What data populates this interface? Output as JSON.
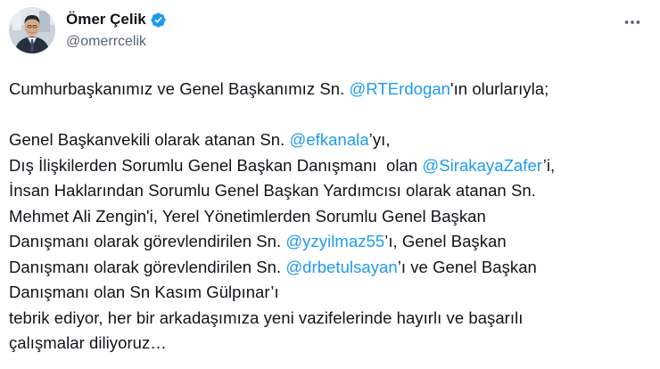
{
  "author": {
    "display_name": "Ömer Çelik",
    "handle": "@omerrcelik",
    "verified": true,
    "brand_color": "#1d9bf0"
  },
  "icons": {
    "more": "more-horizontal-icon",
    "verified": "verified-badge-icon"
  },
  "tweet": {
    "line1": {
      "a": "Cumhurbaşkanımız ve Genel Başkanımız Sn. ",
      "m1": "@RTErdogan",
      "b": "'ın olurlarıyla;"
    },
    "line2": {
      "a": "Genel Başkanvekili olarak atanan Sn. ",
      "m1": "@efkanala",
      "b": "’yı,"
    },
    "line3": {
      "a": "Dış İlişkilerden Sorumlu Genel Başkan Danışmanı  olan ",
      "m1": "@SirakayaZafer",
      "b": "’i,"
    },
    "line4": {
      "a": "İnsan Haklarından Sorumlu Genel Başkan Yardımcısı olarak atanan Sn."
    },
    "line5": {
      "a": "Mehmet Ali Zengin'i, Yerel Yönetimlerden Sorumlu Genel Başkan"
    },
    "line6": {
      "a": "Danışmanı olarak görevlendirilen Sn. ",
      "m1": "@yzyilmaz55",
      "b": "’ı, Genel Başkan"
    },
    "line7": {
      "a": "Danışmanı olarak görevlendirilen Sn. ",
      "m1": "@drbetulsayan",
      "b": "’ı ve Genel Başkan"
    },
    "line8": {
      "a": "Danışmanı olan Sn Kasım Gülpınar’ı"
    },
    "line9": {
      "a": "tebrik ediyor, her bir arkadaşımıza yeni vazifelerinde hayırlı ve başarılı"
    },
    "line10": {
      "a": "çalışmalar diliyoruz…"
    }
  }
}
